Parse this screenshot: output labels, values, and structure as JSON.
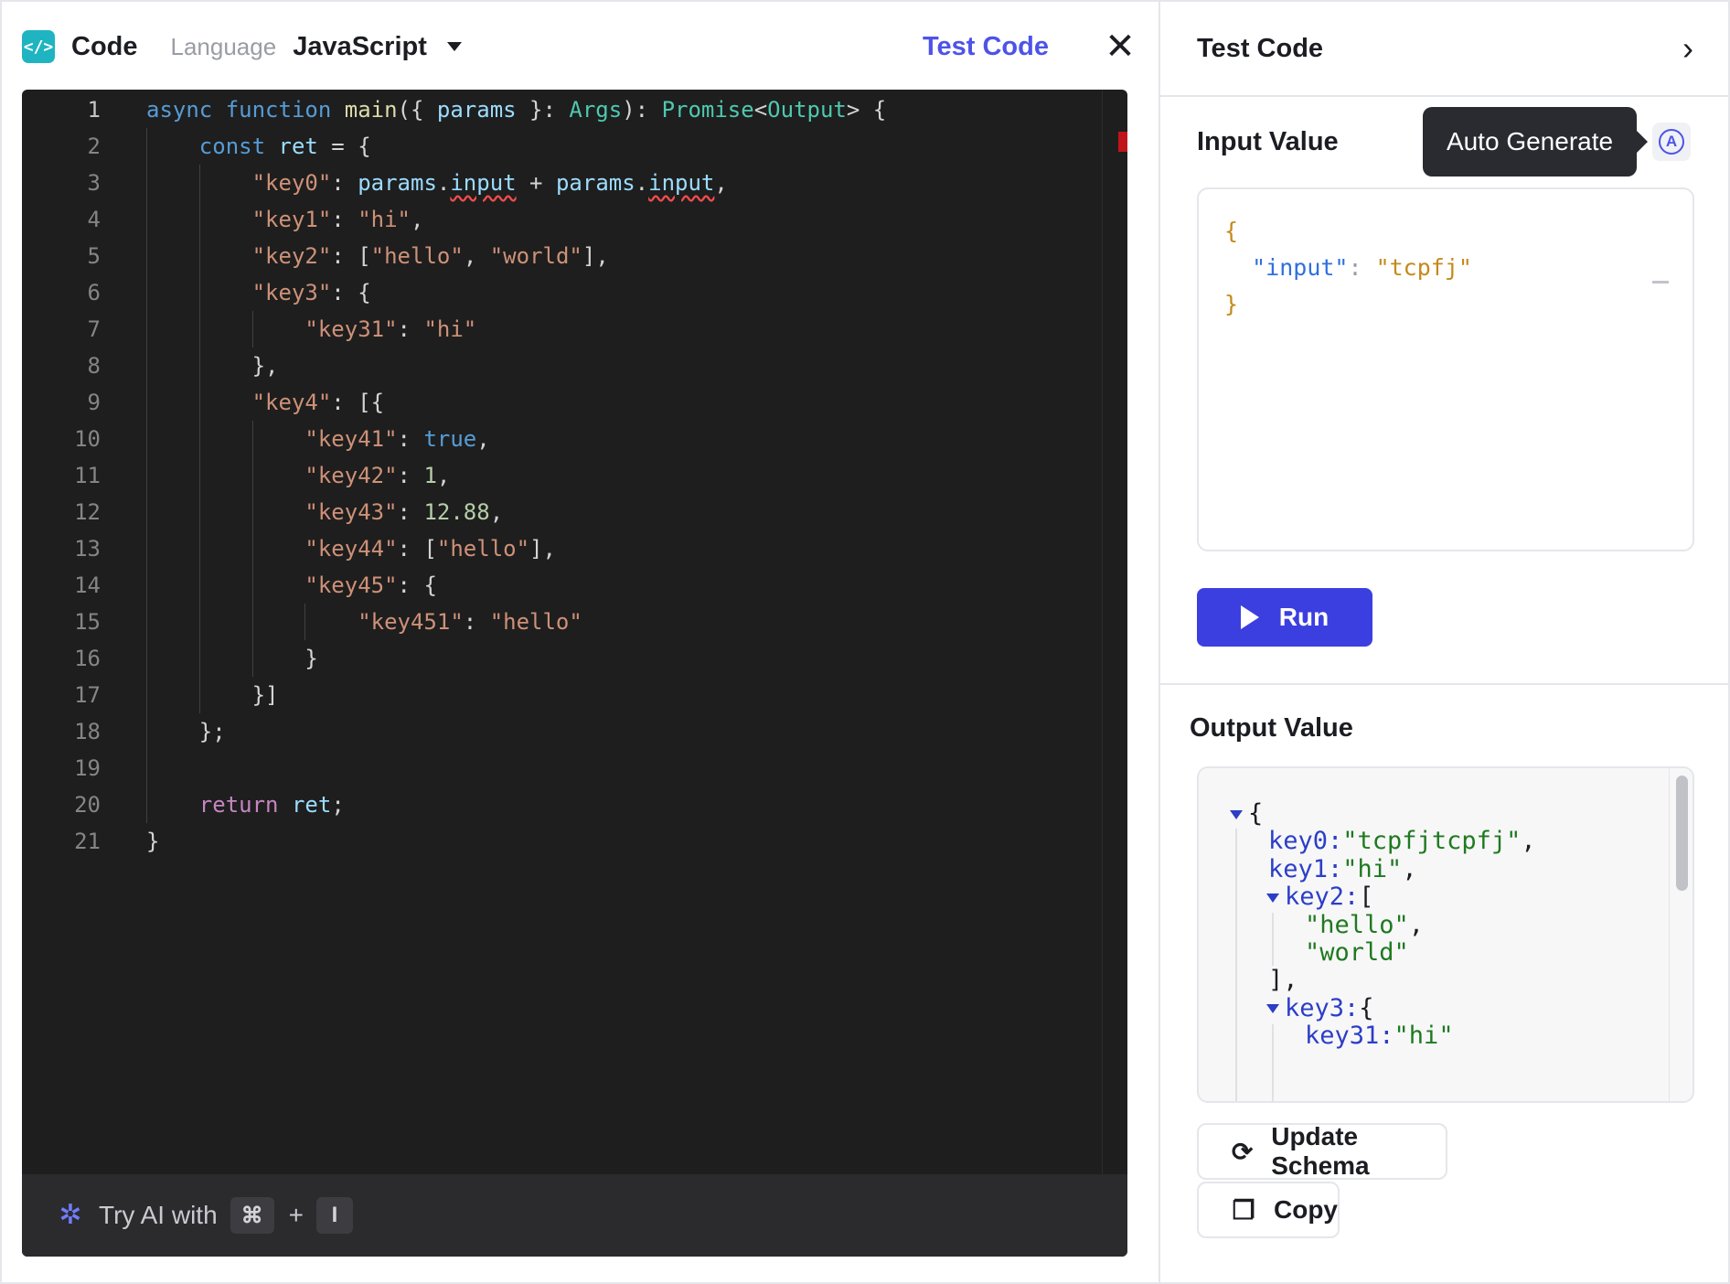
{
  "left_panel": {
    "title": "Code",
    "language_label": "Language",
    "language_value": "JavaScript",
    "test_code_link": "Test Code",
    "close_glyph": "✕",
    "logo_glyph": "</>",
    "icons": {
      "logo": "code-logo-icon",
      "dropdown": "caret-down-icon",
      "close": "close-icon"
    },
    "ai_bar": {
      "icon_glyph": "✲",
      "text": "Try AI with",
      "key1": "⌘",
      "plus": "+",
      "key2": "I"
    }
  },
  "editor": {
    "active_line": 1,
    "lines": [
      {
        "n": "1",
        "indent": 0,
        "tokens": [
          [
            "k",
            "async "
          ],
          [
            "k",
            "function "
          ],
          [
            "f",
            "main"
          ],
          [
            "p",
            "({ "
          ],
          [
            "v",
            "params"
          ],
          [
            "p",
            " }: "
          ],
          [
            "t",
            "Args"
          ],
          [
            "p",
            "): "
          ],
          [
            "t",
            "Promise"
          ],
          [
            "p",
            "<"
          ],
          [
            "t",
            "Output"
          ],
          [
            "p",
            "> {"
          ]
        ]
      },
      {
        "n": "2",
        "indent": 1,
        "tokens": [
          [
            "k",
            "const "
          ],
          [
            "v",
            "ret"
          ],
          [
            "p",
            " = {"
          ]
        ]
      },
      {
        "n": "3",
        "indent": 2,
        "tokens": [
          [
            "s",
            "\"key0\""
          ],
          [
            "p",
            ": "
          ],
          [
            "v",
            "params"
          ],
          [
            "p",
            "."
          ],
          [
            "v sq",
            "input"
          ],
          [
            "p",
            " + "
          ],
          [
            "v",
            "params"
          ],
          [
            "p",
            "."
          ],
          [
            "v sq",
            "input"
          ],
          [
            "p",
            ","
          ]
        ]
      },
      {
        "n": "4",
        "indent": 2,
        "tokens": [
          [
            "s",
            "\"key1\""
          ],
          [
            "p",
            ": "
          ],
          [
            "s",
            "\"hi\""
          ],
          [
            "p",
            ","
          ]
        ]
      },
      {
        "n": "5",
        "indent": 2,
        "tokens": [
          [
            "s",
            "\"key2\""
          ],
          [
            "p",
            ": ["
          ],
          [
            "s",
            "\"hello\""
          ],
          [
            "p",
            ", "
          ],
          [
            "s",
            "\"world\""
          ],
          [
            "p",
            "],"
          ]
        ]
      },
      {
        "n": "6",
        "indent": 2,
        "tokens": [
          [
            "s",
            "\"key3\""
          ],
          [
            "p",
            ": {"
          ]
        ]
      },
      {
        "n": "7",
        "indent": 3,
        "tokens": [
          [
            "s",
            "\"key31\""
          ],
          [
            "p",
            ": "
          ],
          [
            "s",
            "\"hi\""
          ]
        ]
      },
      {
        "n": "8",
        "indent": 2,
        "tokens": [
          [
            "p",
            "},"
          ]
        ]
      },
      {
        "n": "9",
        "indent": 2,
        "tokens": [
          [
            "s",
            "\"key4\""
          ],
          [
            "p",
            ": [{"
          ]
        ]
      },
      {
        "n": "10",
        "indent": 3,
        "tokens": [
          [
            "s",
            "\"key41\""
          ],
          [
            "p",
            ": "
          ],
          [
            "k",
            "true"
          ],
          [
            "p",
            ","
          ]
        ]
      },
      {
        "n": "11",
        "indent": 3,
        "tokens": [
          [
            "s",
            "\"key42\""
          ],
          [
            "p",
            ": "
          ],
          [
            "n",
            "1"
          ],
          [
            "p",
            ","
          ]
        ]
      },
      {
        "n": "12",
        "indent": 3,
        "tokens": [
          [
            "s",
            "\"key43\""
          ],
          [
            "p",
            ": "
          ],
          [
            "n",
            "12.88"
          ],
          [
            "p",
            ","
          ]
        ]
      },
      {
        "n": "13",
        "indent": 3,
        "tokens": [
          [
            "s",
            "\"key44\""
          ],
          [
            "p",
            ": ["
          ],
          [
            "s",
            "\"hello\""
          ],
          [
            "p",
            "],"
          ]
        ]
      },
      {
        "n": "14",
        "indent": 3,
        "tokens": [
          [
            "s",
            "\"key45\""
          ],
          [
            "p",
            ": {"
          ]
        ]
      },
      {
        "n": "15",
        "indent": 4,
        "tokens": [
          [
            "s",
            "\"key451\""
          ],
          [
            "p",
            ": "
          ],
          [
            "s",
            "\"hello\""
          ]
        ]
      },
      {
        "n": "16",
        "indent": 3,
        "tokens": [
          [
            "p",
            "}"
          ]
        ]
      },
      {
        "n": "17",
        "indent": 2,
        "tokens": [
          [
            "p",
            "}]"
          ]
        ]
      },
      {
        "n": "18",
        "indent": 1,
        "tokens": [
          [
            "p",
            "};"
          ]
        ]
      },
      {
        "n": "19",
        "indent": 1,
        "tokens": []
      },
      {
        "n": "20",
        "indent": 1,
        "tokens": [
          [
            "ret",
            "return "
          ],
          [
            "v",
            "ret"
          ],
          [
            "p",
            ";"
          ]
        ]
      },
      {
        "n": "21",
        "indent": 0,
        "tokens": [
          [
            "p",
            "}"
          ]
        ]
      }
    ]
  },
  "right_panel": {
    "title": "Test Code",
    "collapse_glyph": "›",
    "input_label": "Input Value",
    "auto_generate_tooltip": "Auto Generate",
    "auto_generate_glyph": "A",
    "input_json": {
      "open": "{",
      "key": "\"input\"",
      "colon": ": ",
      "value": "\"tcpfj\"",
      "close": "}"
    },
    "run_label": "Run",
    "output_label": "Output Value",
    "output_tree": [
      {
        "depth": 0,
        "toggle": true,
        "parts": [
          [
            "opun",
            "{"
          ]
        ]
      },
      {
        "depth": 1,
        "toggle": false,
        "parts": [
          [
            "okey",
            "key0:"
          ],
          [
            "ostr",
            "\"tcpfjtcpfj\""
          ],
          [
            "opun",
            ","
          ]
        ]
      },
      {
        "depth": 1,
        "toggle": false,
        "parts": [
          [
            "okey",
            "key1:"
          ],
          [
            "ostr",
            "\"hi\""
          ],
          [
            "opun",
            ","
          ]
        ]
      },
      {
        "depth": 1,
        "toggle": true,
        "parts": [
          [
            "okey",
            "key2:"
          ],
          [
            "opun",
            "["
          ]
        ]
      },
      {
        "depth": 2,
        "toggle": false,
        "parts": [
          [
            "ostr",
            "\"hello\""
          ],
          [
            "opun",
            ","
          ]
        ]
      },
      {
        "depth": 2,
        "toggle": false,
        "parts": [
          [
            "ostr",
            "\"world\""
          ]
        ]
      },
      {
        "depth": 1,
        "toggle": false,
        "parts": [
          [
            "opun",
            "],"
          ]
        ]
      },
      {
        "depth": 1,
        "toggle": true,
        "parts": [
          [
            "okey",
            "key3:"
          ],
          [
            "opun",
            "{"
          ]
        ]
      },
      {
        "depth": 2,
        "toggle": false,
        "parts": [
          [
            "okey",
            "key31:"
          ],
          [
            "ostr",
            "\"hi\""
          ]
        ]
      }
    ],
    "update_schema_label": "Update Schema",
    "update_schema_glyph": "⟳",
    "copy_label": "Copy",
    "copy_glyph": "❐"
  }
}
